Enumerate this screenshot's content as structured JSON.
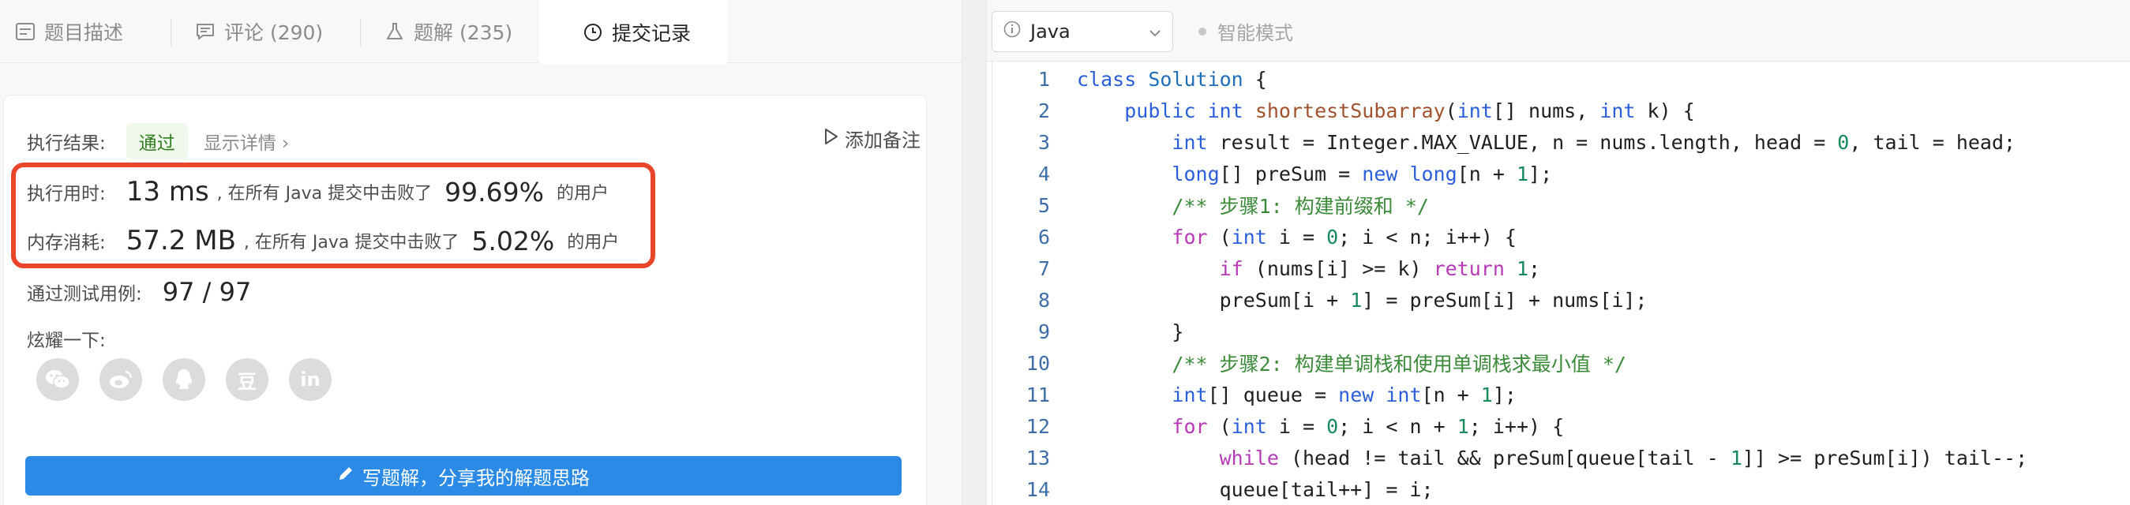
{
  "tabs": [
    {
      "label": "题目描述",
      "icon": "description-icon"
    },
    {
      "label": "评论 (290)",
      "icon": "comment-icon"
    },
    {
      "label": "题解 (235)",
      "icon": "flask-icon"
    },
    {
      "label": "提交记录",
      "icon": "clock-icon"
    }
  ],
  "result": {
    "label": "执行结果:",
    "status": "通过",
    "details_link": "显示详情 ›",
    "add_note": "添加备注"
  },
  "runtime": {
    "label": "执行用时:",
    "value": "13 ms",
    "middle_text": ", 在所有 Java 提交中击败了",
    "percent": "99.69%",
    "suffix": "的用户"
  },
  "memory": {
    "label": "内存消耗:",
    "value": "57.2 MB",
    "middle_text": ", 在所有 Java 提交中击败了",
    "percent": "5.02%",
    "suffix": "的用户"
  },
  "tests": {
    "label": "通过测试用例:",
    "value": "97 / 97"
  },
  "share": {
    "label": "炫耀一下:",
    "icons": [
      "wechat-icon",
      "weibo-icon",
      "qq-icon",
      "douban-icon",
      "linkedin-icon"
    ],
    "douban_glyph": "豆",
    "linkedin_glyph": "in"
  },
  "write_solution": "写题解，分享我的解题思路",
  "editor": {
    "language": "Java",
    "smart_mode": "智能模式",
    "lines": [
      {
        "n": "1"
      },
      {
        "n": "2"
      },
      {
        "n": "3"
      },
      {
        "n": "4"
      },
      {
        "n": "5"
      },
      {
        "n": "6"
      },
      {
        "n": "7"
      },
      {
        "n": "8"
      },
      {
        "n": "9"
      },
      {
        "n": "10"
      },
      {
        "n": "11"
      },
      {
        "n": "12"
      },
      {
        "n": "13"
      },
      {
        "n": "14"
      }
    ],
    "code": {
      "l1": [
        "class",
        " ",
        "Solution",
        " {"
      ],
      "l2": [
        "    ",
        "public",
        " ",
        "int",
        " ",
        "shortestSubarray",
        "(",
        "int",
        "[] nums, ",
        "int",
        " k) {"
      ],
      "l3": [
        "        ",
        "int",
        " result = Integer.MAX_VALUE, n = nums.length, head = ",
        "0",
        ", tail = head;"
      ],
      "l4": [
        "        ",
        "long",
        "[] preSum = ",
        "new",
        " ",
        "long",
        "[n + ",
        "1",
        "];"
      ],
      "l5": [
        "        ",
        "/** 步骤1: 构建前缀和 */"
      ],
      "l6": [
        "        ",
        "for",
        " (",
        "int",
        " i = ",
        "0",
        "; i < n; i++) {"
      ],
      "l7": [
        "            ",
        "if",
        " (nums[i] >= k) ",
        "return",
        " ",
        "1",
        ";"
      ],
      "l8": [
        "            preSum[i + ",
        "1",
        "] = preSum[i] + nums[i];"
      ],
      "l9": [
        "        }"
      ],
      "l10": [
        "        ",
        "/** 步骤2: 构建单调栈和使用单调栈求最小值 */"
      ],
      "l11": [
        "        ",
        "int",
        "[] queue = ",
        "new",
        " ",
        "int",
        "[n + ",
        "1",
        "];"
      ],
      "l12": [
        "        ",
        "for",
        " (",
        "int",
        " i = ",
        "0",
        "; i < n + ",
        "1",
        "; i++) {"
      ],
      "l13": [
        "            ",
        "while",
        " (head != tail && preSum[queue[tail - ",
        "1",
        "]] >= preSum[i]) tail--;"
      ],
      "l14": [
        "            queue[tail++] = i;"
      ]
    }
  },
  "colors": {
    "accent": "#2b8ae6",
    "highlight_border": "#e8462b",
    "pass_text": "#2f7d1f"
  }
}
